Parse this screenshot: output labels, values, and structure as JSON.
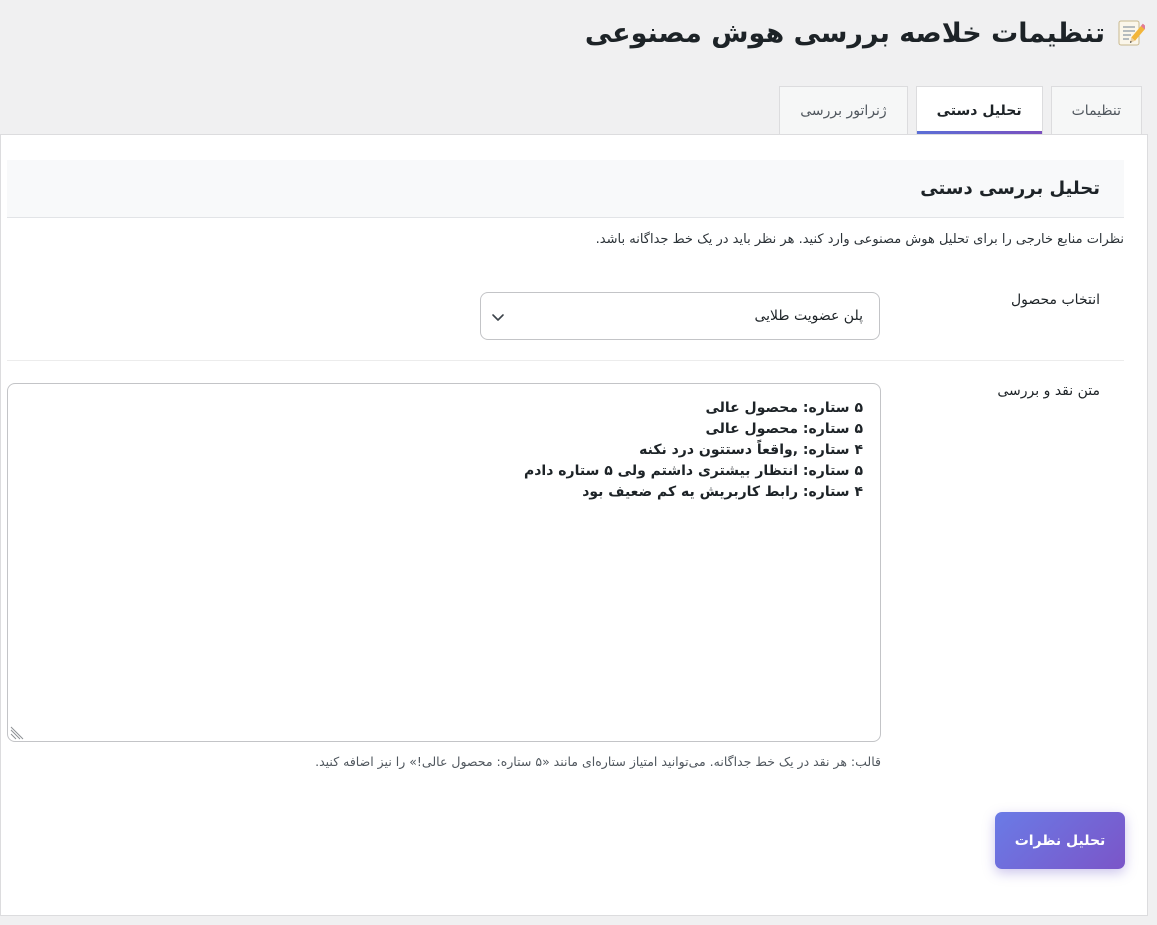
{
  "page": {
    "title": "تنظیمات خلاصه بررسی هوش مصنوعی",
    "icon": "memo-icon"
  },
  "tabs": [
    {
      "label": "تنظیمات",
      "active": false
    },
    {
      "label": "تحلیل دستی",
      "active": true
    },
    {
      "label": "ژنراتور بررسی",
      "active": false
    }
  ],
  "section": {
    "title": "تحلیل بررسی دستی",
    "intro": "نظرات منابع خارجی را برای تحلیل هوش مصنوعی وارد کنید. هر نظر باید در یک خط جداگانه باشد."
  },
  "product": {
    "label": "انتخاب محصول",
    "selected": "پلن عضویت طلایی"
  },
  "review": {
    "label": "متن نقد و بررسی",
    "lines": [
      "۵ ستاره: محصول عالی",
      "۵ ستاره: محصول عالی",
      "۴ ستاره: ,واقعاً دستتون درد نکنه",
      "۵ ستاره: انتظار بیشتری داشتم ولی ۵ ستاره دادم",
      "۴ ستاره: رابط کاربریش یه کم ضعیف بود"
    ],
    "hint": "قالب: هر نقد در یک خط جداگانه. می‌توانید امتیاز ستاره‌ای مانند «۵ ستاره: محصول عالی!» را نیز اضافه کنید."
  },
  "actions": {
    "analyze_label": "تحلیل نظرات"
  },
  "colors": {
    "accent_start": "#6a7be6",
    "accent_end": "#7b55c8",
    "background": "#f0f0f1"
  }
}
